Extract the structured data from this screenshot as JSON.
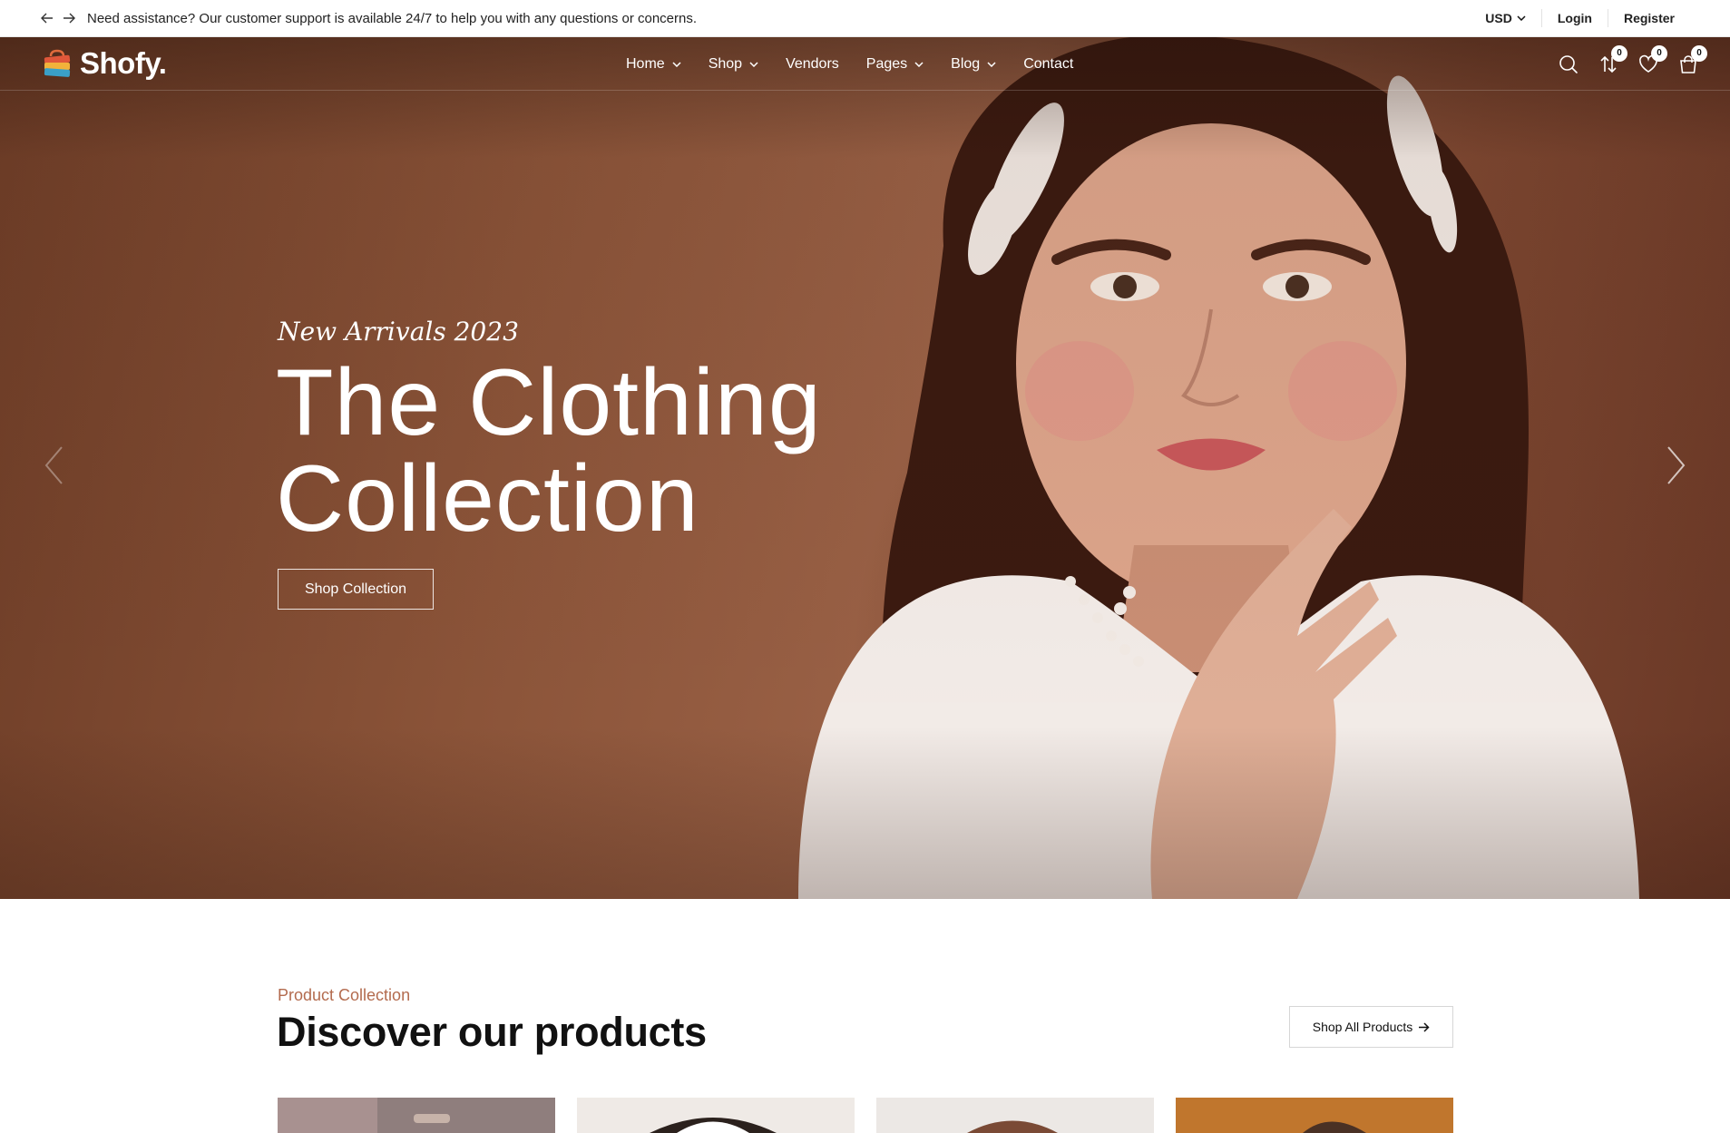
{
  "topbar": {
    "notice": "Need assistance? Our customer support is available 24/7 to help you with any questions or concerns.",
    "currency": "USD",
    "login": "Login",
    "register": "Register"
  },
  "brand": {
    "name": "Shofy."
  },
  "nav": {
    "items": [
      {
        "label": "Home",
        "has_dropdown": true
      },
      {
        "label": "Shop",
        "has_dropdown": true
      },
      {
        "label": "Vendors",
        "has_dropdown": false
      },
      {
        "label": "Pages",
        "has_dropdown": true
      },
      {
        "label": "Blog",
        "has_dropdown": true
      },
      {
        "label": "Contact",
        "has_dropdown": false
      }
    ],
    "icons": [
      {
        "name": "search-icon"
      },
      {
        "name": "compare-icon",
        "count": "0"
      },
      {
        "name": "heart-icon",
        "count": "0"
      },
      {
        "name": "cart-icon",
        "count": "0"
      }
    ]
  },
  "hero": {
    "kicker": "New Arrivals 2023",
    "title_line1": "The Clothing",
    "title_line2": "Collection",
    "cta": "Shop Collection"
  },
  "products": {
    "kicker": "Product Collection",
    "title": "Discover our products",
    "shop_all": "Shop All Products"
  },
  "colors": {
    "accent": "#b36b4e",
    "hero_bg": "#8a5338"
  }
}
